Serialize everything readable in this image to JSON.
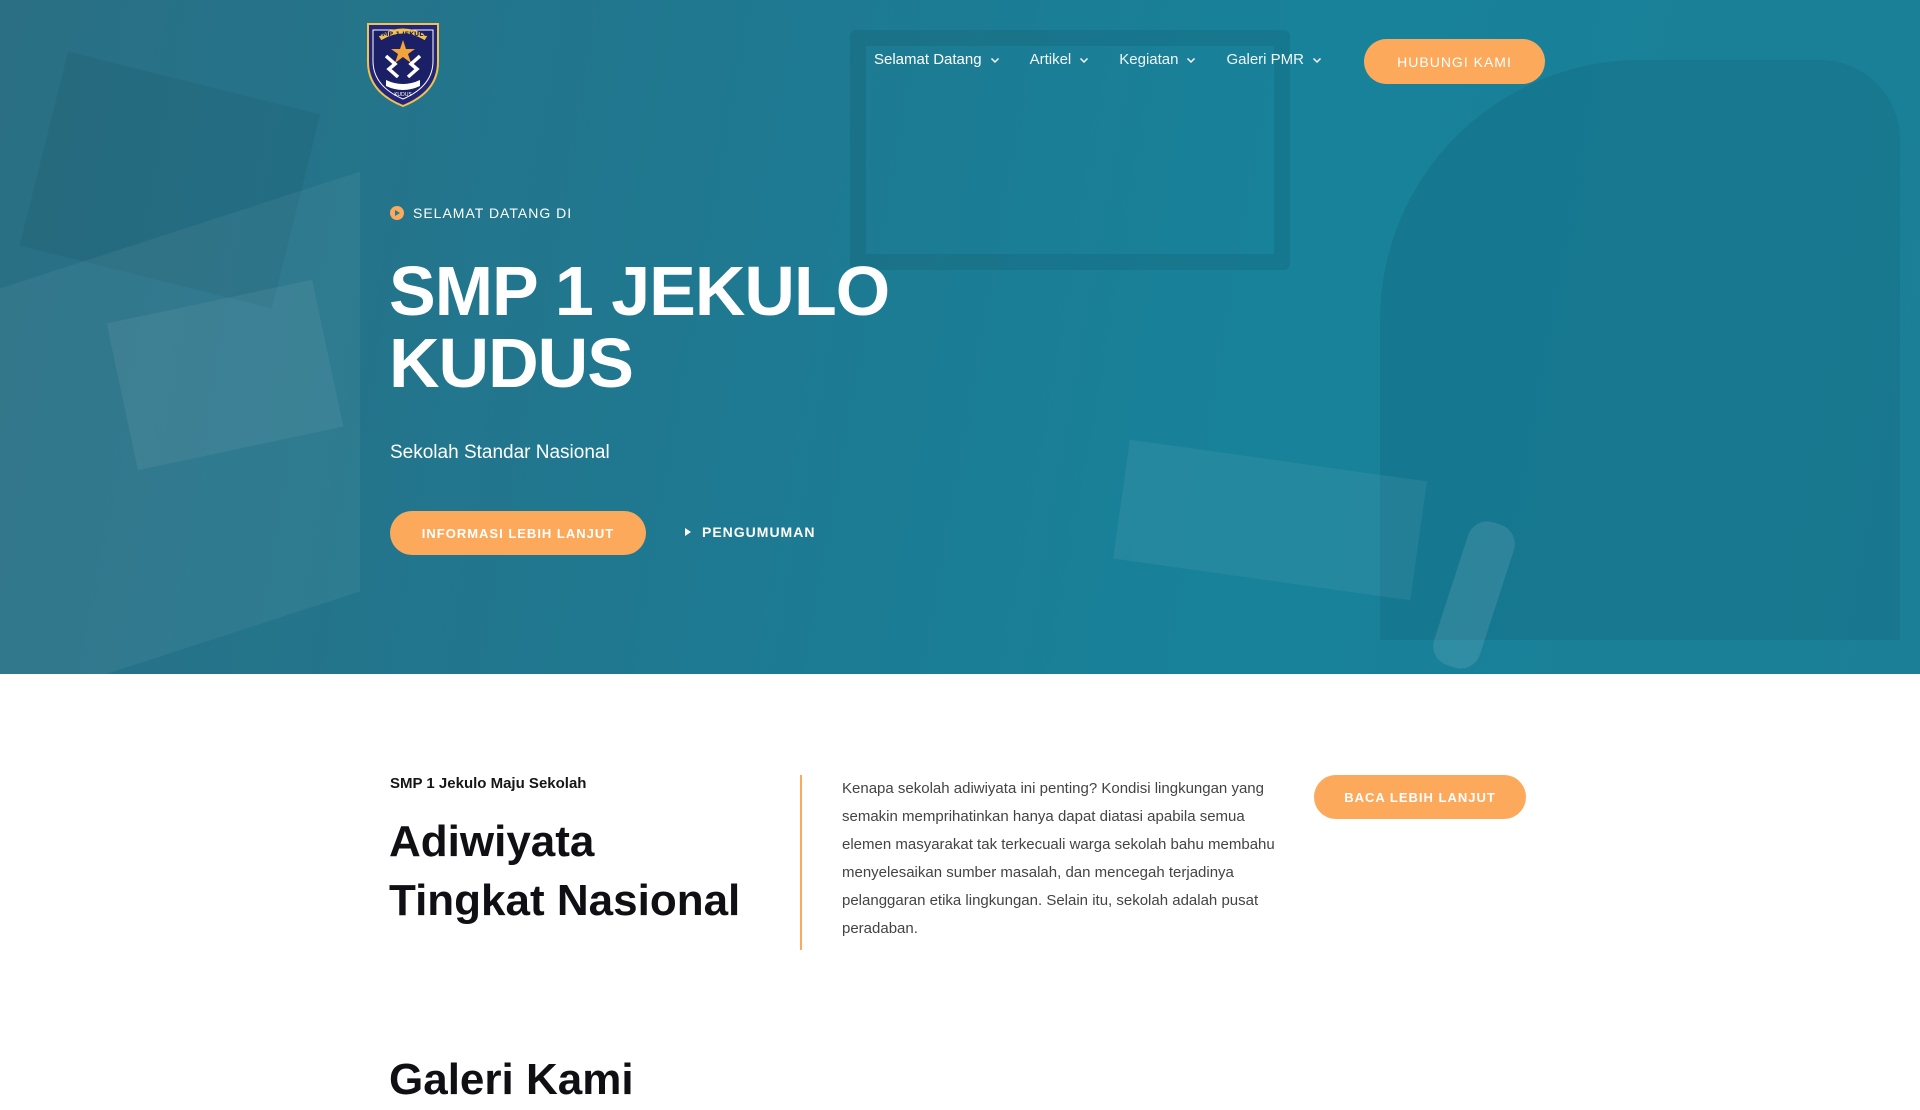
{
  "header": {
    "logo_text_top": "SMP 1 JEKULO",
    "logo_text_bottom": "KUDUS",
    "nav": [
      {
        "label": "Selamat Datang"
      },
      {
        "label": "Artikel"
      },
      {
        "label": "Kegiatan"
      },
      {
        "label": "Galeri PMR"
      }
    ],
    "contact_button": "HUBUNGI KAMI"
  },
  "hero": {
    "kicker": "SELAMAT DATANG DI",
    "title_line1": "SMP 1 JEKULO",
    "title_line2": "KUDUS",
    "subtitle": "Sekolah Standar Nasional",
    "primary_button": "INFORMASI LEBIH LANJUT",
    "secondary_link": "PENGUMUMAN"
  },
  "about": {
    "kicker": "SMP 1 Jekulo Maju Sekolah",
    "title_line1": "Adiwiyata",
    "title_line2": "Tingkat Nasional",
    "body": "Kenapa sekolah adiwiyata ini penting? Kondisi lingkungan yang semakin memprihatinkan hanya dapat diatasi apabila semua elemen masyarakat tak terkecuali warga sekolah bahu membahu menyelesaikan sumber masalah, dan mencegah terjadinya pelanggaran etika lingkungan. Selain itu, sekolah adalah pusat peradaban.",
    "button": "BACA LEBIH LANJUT"
  },
  "gallery": {
    "title": "Galeri Kami"
  },
  "colors": {
    "accent": "#fca95b",
    "hero_bg": "#1b7f97",
    "text_dark": "#0f0f14"
  }
}
